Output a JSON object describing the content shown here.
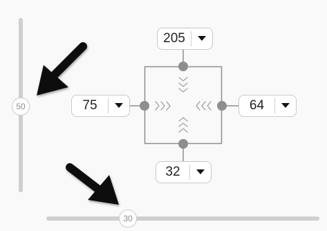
{
  "sliders": {
    "vertical": {
      "value_label": "50"
    },
    "horizontal": {
      "value_label": "30"
    }
  },
  "margins": {
    "top": {
      "value": "205"
    },
    "left": {
      "value": "75"
    },
    "right": {
      "value": "64"
    },
    "bottom": {
      "value": "32"
    }
  },
  "icons": {
    "dropdown": "chevron-down-icon",
    "pointer": "black-arrow-icon",
    "direction_chevrons": "chevron-icon"
  },
  "colors": {
    "track": "#cfcfcf",
    "diagram": "#8e8e8e",
    "arrow": "#111111"
  }
}
